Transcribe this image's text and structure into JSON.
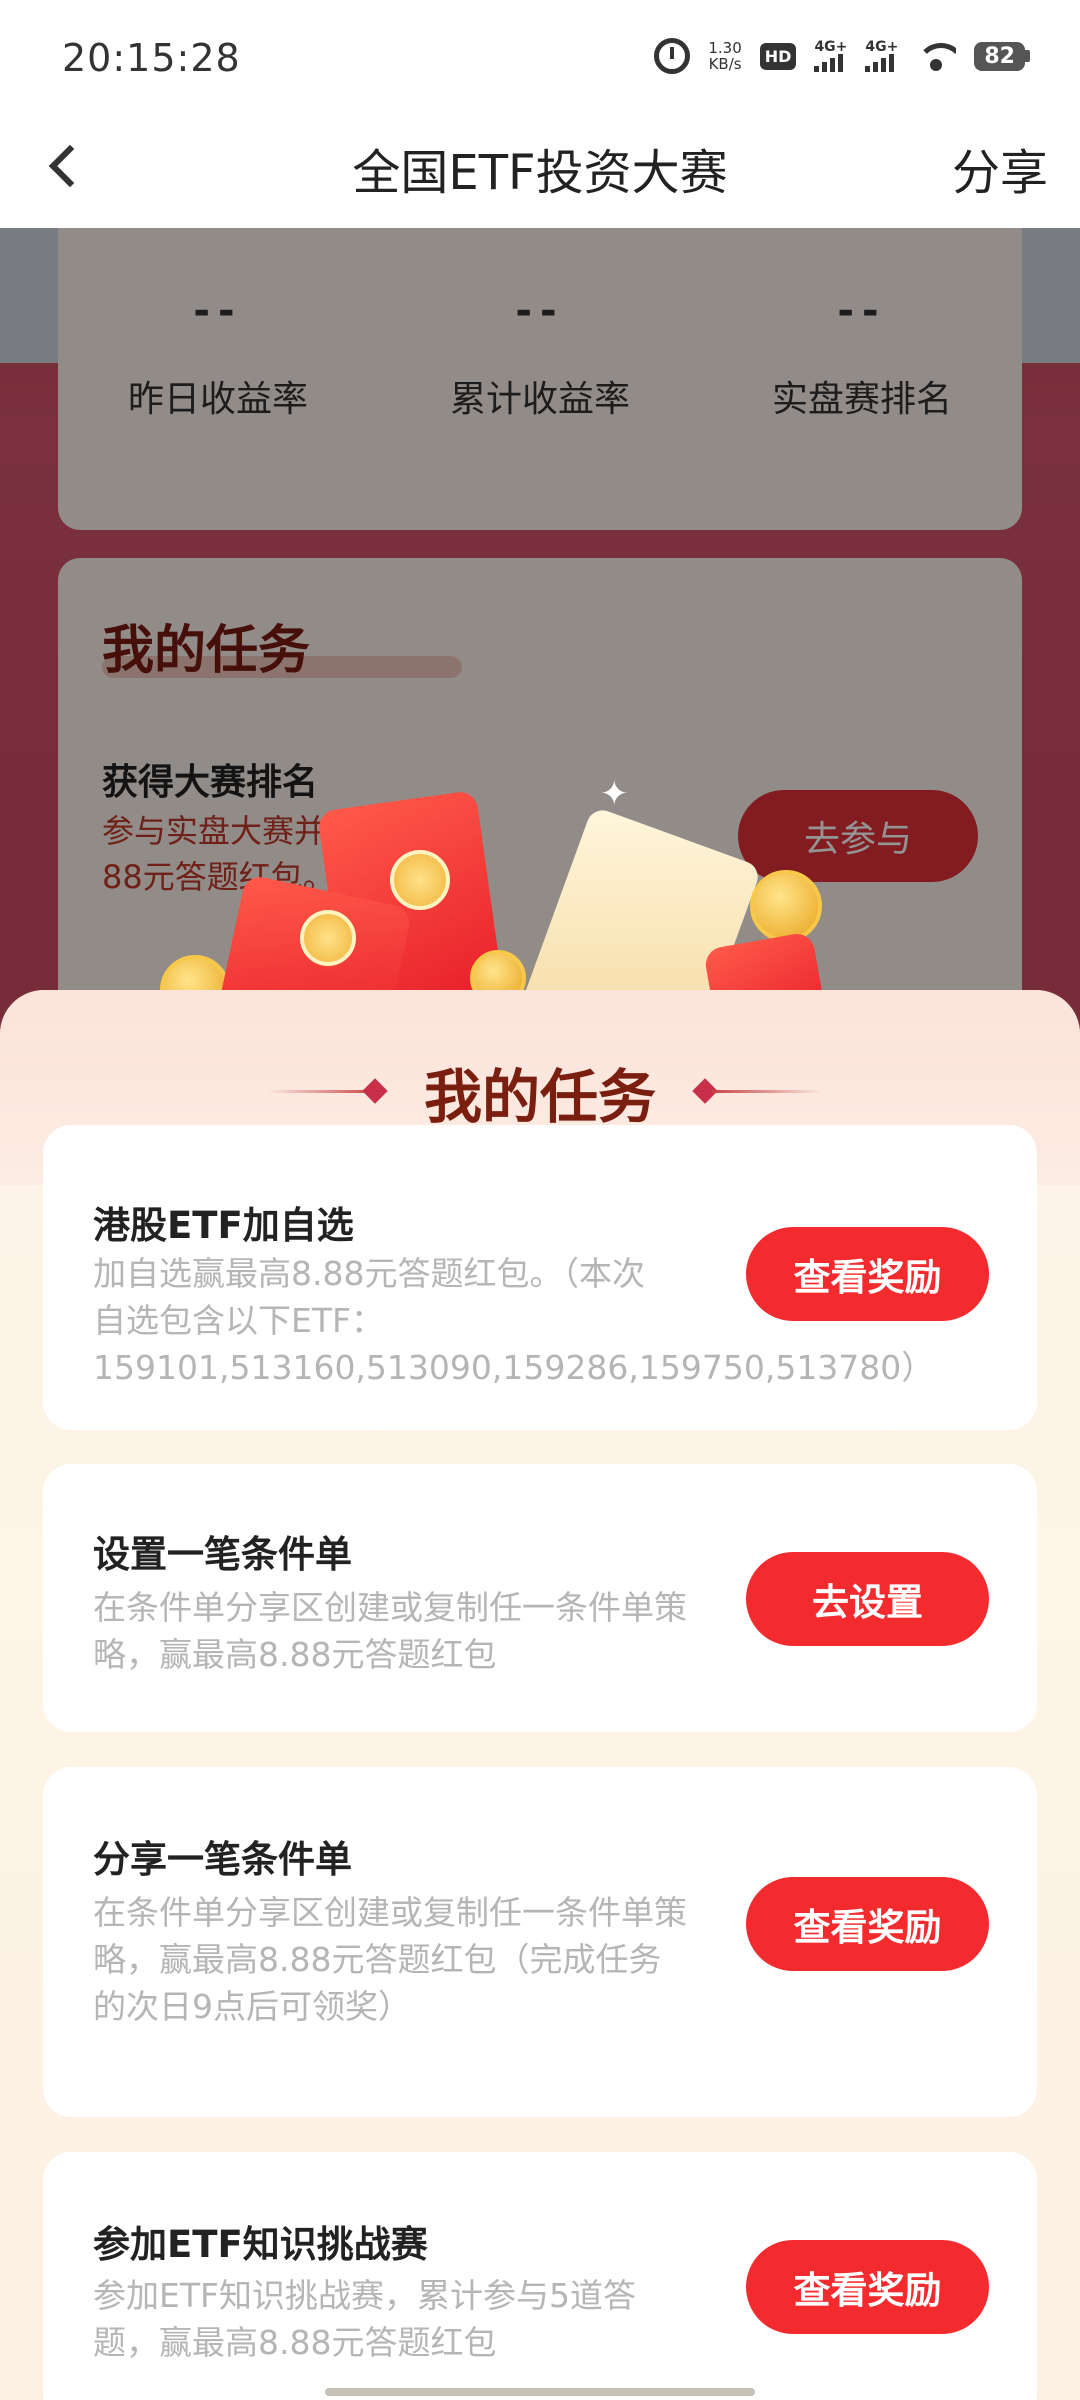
{
  "status_bar": {
    "time": "20:15:28",
    "net_speed_value": "1.30",
    "net_speed_unit": "KB/s",
    "hd_label": "HD",
    "hd_sub": "1 2",
    "signal1_label": "4G+",
    "signal2_label": "4G+",
    "battery": "82"
  },
  "header": {
    "title": "全国ETF投资大赛",
    "share_label": "分享"
  },
  "background": {
    "stats": [
      {
        "value": "--",
        "label": "昨日收益率"
      },
      {
        "value": "--",
        "label": "累计收益率"
      },
      {
        "value": "--",
        "label": "实盘赛排名"
      }
    ],
    "task_section_title": "我的任务",
    "task_name": "获得大赛排名",
    "task_desc_prefix": "参与实盘大赛并获得",
    "task_desc_suffix": "88元答题红包。",
    "join_label": "去参与"
  },
  "sheet": {
    "title": "我的任务",
    "tasks": [
      {
        "name": "港股ETF加自选",
        "desc": "加自选赢最高8.88元答题红包。（本次自选包含以下ETF：159101,513160,513090,159286,159750,513780）",
        "button": "查看奖励"
      },
      {
        "name": "设置一笔条件单",
        "desc": "在条件单分享区创建或复制任一条件单策略，赢最高8.88元答题红包",
        "button": "去设置"
      },
      {
        "name": "分享一笔条件单",
        "desc": "在条件单分享区创建或复制任一条件单策略，赢最高8.88元答题红包（完成任务的次日9点后可领奖）",
        "button": "查看奖励"
      },
      {
        "name": "参加ETF知识挑战赛",
        "desc": "参加ETF知识挑战赛，累计参与5道答题，赢最高8.88元答题红包",
        "button": "查看奖励"
      }
    ]
  },
  "colors": {
    "accent_red": "#f42b2e",
    "title_brown": "#7a1e10",
    "muted_text": "#b5b5b5"
  }
}
